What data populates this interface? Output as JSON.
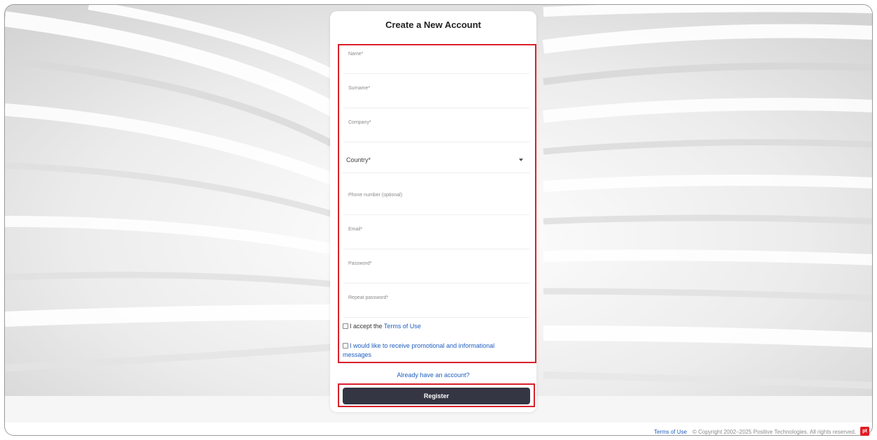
{
  "form": {
    "title": "Create a New Account",
    "fields": [
      {
        "label": "Name*",
        "value": ""
      },
      {
        "label": "Surname*",
        "value": ""
      },
      {
        "label": "Company*",
        "value": ""
      },
      {
        "label": "Phone number (optional)",
        "value": ""
      },
      {
        "label": "Email*",
        "value": ""
      },
      {
        "label": "Password*",
        "value": ""
      },
      {
        "label": "Repeat password*",
        "value": ""
      }
    ],
    "country": {
      "label": "Country*"
    },
    "terms_checkbox": {
      "prefix": "I accept the ",
      "link": "Terms of Use"
    },
    "promo_checkbox": {
      "label": "I would like to receive promotional and informational messages"
    },
    "already_account": "Already have an account?",
    "register_label": "Register"
  },
  "footer": {
    "terms": "Terms of Use",
    "copyright": "© Copyright 2002–2025 Positive Technologies. All rights reserved.",
    "logo_text": "pt"
  },
  "colors": {
    "accent": "#d9202a",
    "link": "#1f5fbf",
    "button": "#343644"
  }
}
